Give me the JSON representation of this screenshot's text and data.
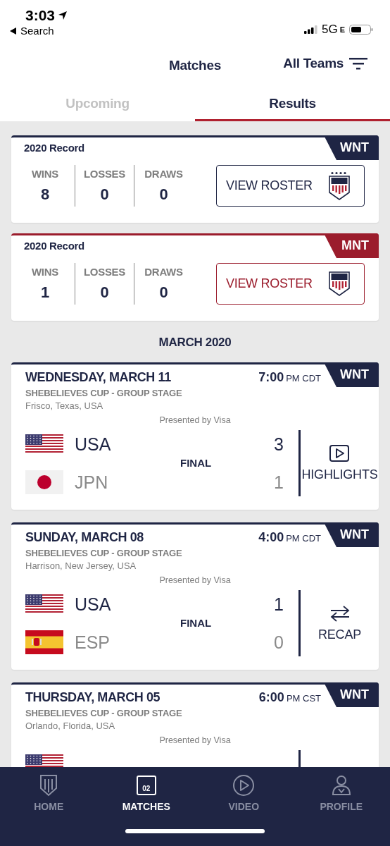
{
  "status_bar": {
    "time": "3:03",
    "back_label": "Search",
    "network": "5G",
    "network_suffix": "E"
  },
  "header": {
    "title": "Matches",
    "filter_label": "All Teams"
  },
  "tabs": [
    {
      "label": "Upcoming",
      "selected": false
    },
    {
      "label": "Results",
      "selected": true
    }
  ],
  "records": [
    {
      "title": "2020 Record",
      "team": "WNT",
      "color": "#1f2544",
      "stats": [
        {
          "label": "WINS",
          "value": "8"
        },
        {
          "label": "LOSSES",
          "value": "0"
        },
        {
          "label": "DRAWS",
          "value": "0"
        }
      ],
      "button": "VIEW ROSTER",
      "crest_stars": true
    },
    {
      "title": "2020 Record",
      "team": "MNT",
      "color": "#9b1c2c",
      "stats": [
        {
          "label": "WINS",
          "value": "1"
        },
        {
          "label": "LOSSES",
          "value": "0"
        },
        {
          "label": "DRAWS",
          "value": "0"
        }
      ],
      "button": "VIEW ROSTER",
      "crest_stars": false
    }
  ],
  "month": "MARCH 2020",
  "matches": [
    {
      "date": "WEDNESDAY, MARCH 11",
      "time": "7:00",
      "time_suffix": "PM CDT",
      "team": "WNT",
      "competition": "SHEBELIEVES CUP - GROUP STAGE",
      "location": "Frisco, Texas, USA",
      "sponsor": "Presented by Visa",
      "status": "FINAL",
      "teams": [
        {
          "kind": "usa",
          "name": "USA",
          "score": "3",
          "winner": true
        },
        {
          "kind": "jpn",
          "name": "JPN",
          "score": "1",
          "winner": false
        }
      ],
      "action": {
        "kind": "highlights",
        "label": "HIGHLIGHTS"
      }
    },
    {
      "date": "SUNDAY, MARCH 08",
      "time": "4:00",
      "time_suffix": "PM CDT",
      "team": "WNT",
      "competition": "SHEBELIEVES CUP - GROUP STAGE",
      "location": "Harrison, New Jersey, USA",
      "sponsor": "Presented by Visa",
      "status": "FINAL",
      "teams": [
        {
          "kind": "usa",
          "name": "USA",
          "score": "1",
          "winner": true
        },
        {
          "kind": "esp",
          "name": "ESP",
          "score": "0",
          "winner": false
        }
      ],
      "action": {
        "kind": "recap",
        "label": "RECAP"
      }
    },
    {
      "date": "THURSDAY, MARCH 05",
      "time": "6:00",
      "time_suffix": "PM CST",
      "team": "WNT",
      "competition": "SHEBELIEVES CUP - GROUP STAGE",
      "location": "Orlando, Florida, USA",
      "sponsor": "Presented by Visa",
      "teams": [
        {
          "kind": "usa"
        }
      ]
    }
  ],
  "nav": [
    {
      "kind": "home",
      "label": "HOME",
      "selected": false
    },
    {
      "kind": "matches",
      "label": "MATCHES",
      "selected": true,
      "day": "02"
    },
    {
      "kind": "video",
      "label": "VIDEO",
      "selected": false
    },
    {
      "kind": "profile",
      "label": "PROFILE",
      "selected": false
    }
  ]
}
